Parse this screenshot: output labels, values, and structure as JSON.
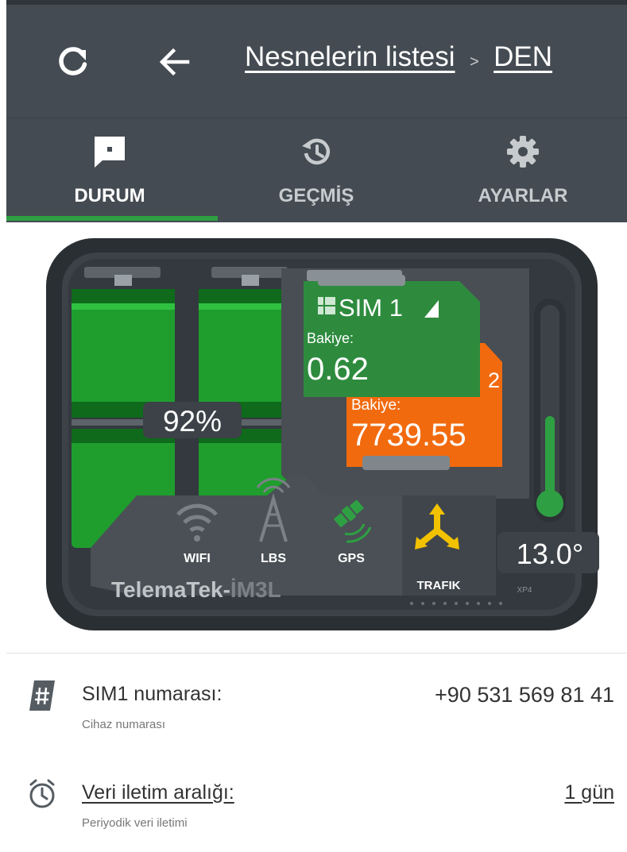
{
  "header": {
    "refresh_icon": "refresh-icon",
    "back_icon": "arrow-left-icon",
    "breadcrumb": {
      "link": "Nesnelerin listesi",
      "separator": ">",
      "current": "DEN"
    }
  },
  "tabs": [
    {
      "label": "DURUM",
      "icon": "message-square-icon",
      "active": true
    },
    {
      "label": "GEÇMİŞ",
      "icon": "history-icon",
      "active": false
    },
    {
      "label": "AYARLAR",
      "icon": "gear-icon",
      "active": false
    }
  ],
  "device": {
    "battery_percent": "92%",
    "sim1": {
      "title": "SIM 1",
      "balance_label": "Bakiye:",
      "balance": "0.62"
    },
    "sim2": {
      "number": "2",
      "balance_label": "Bakiye:",
      "balance": "7739.55"
    },
    "connectivity": {
      "wifi": "WIFI",
      "lbs": "LBS",
      "gps": "GPS"
    },
    "traffic_label": "TRAFIK",
    "temperature": "13.0°",
    "model_prefix": "TelemaTek-",
    "model_suffix": "İM3L",
    "chip_label": "XP4",
    "colors": {
      "battery": "#1f9e2e",
      "sim1": "#2e8b3e",
      "sim2": "#f26a0e",
      "traffic": "#f2c200",
      "thermo": "#2ea043"
    }
  },
  "rows": [
    {
      "title": "SIM1 numarası:",
      "subtitle": "Cihaz numarası",
      "value": "+90 531 569 81 41",
      "icon": "hash-icon"
    },
    {
      "title": "Veri iletim aralığı:",
      "subtitle": "Periyodik veri iletimi",
      "value": "1 gün",
      "icon": "alarm-clock-icon"
    }
  ]
}
